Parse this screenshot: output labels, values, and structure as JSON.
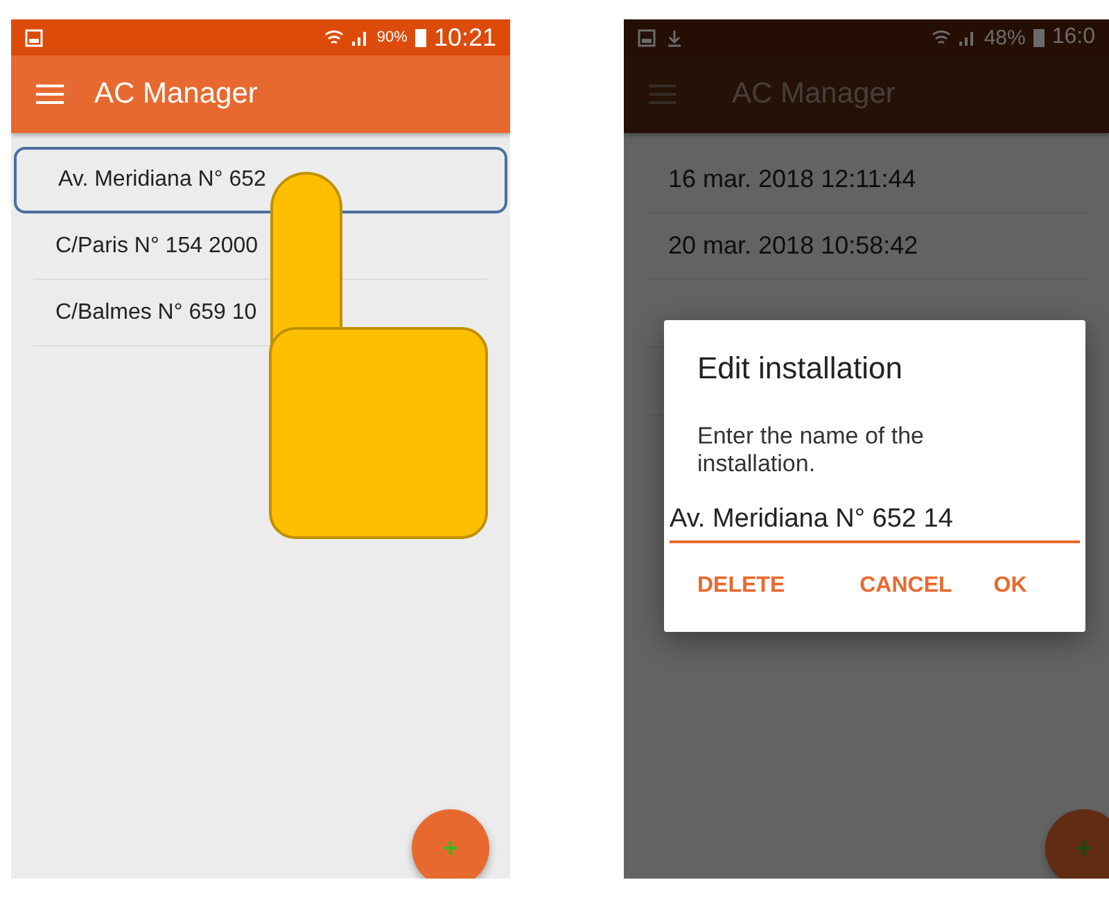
{
  "screens": [
    {
      "status_bar": {
        "battery": "90%",
        "time": "10:21"
      },
      "app_bar": {
        "title": "AC Manager"
      },
      "dimmed": false,
      "touch_indicator": true,
      "items": [
        {
          "label": "Av. Meridiana N° 652",
          "selected": true
        },
        {
          "label": "C/Paris N° 154 2000",
          "selected": false
        },
        {
          "label": "C/Balmes N° 659 10",
          "selected": false
        }
      ]
    },
    {
      "status_bar": {
        "battery": "48%",
        "time": "16:0"
      },
      "app_bar": {
        "title": "AC Manager"
      },
      "dimmed": true,
      "touch_indicator": false,
      "items": [
        {
          "label": "16 mar. 2018 12:11:44",
          "selected": false
        },
        {
          "label": "20 mar. 2018 10:58:42",
          "selected": false
        }
      ],
      "dialog": {
        "title": "Edit installation",
        "message": "Enter the name of the installation.",
        "value": "Av. Meridiana N° 652 14",
        "buttons": [
          "DELETE",
          "CANCEL",
          "OK"
        ]
      }
    }
  ]
}
